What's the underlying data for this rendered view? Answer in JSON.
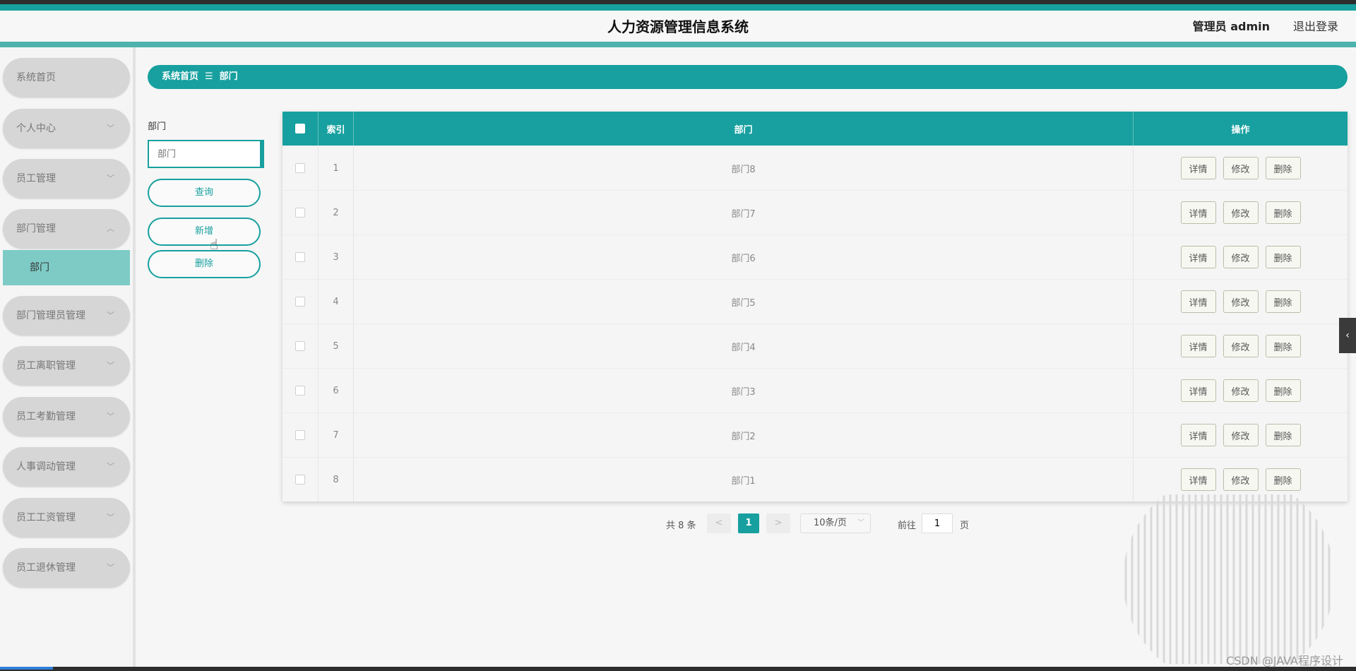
{
  "header": {
    "title": "人力资源管理信息系统",
    "admin": "管理员 admin",
    "logout": "退出登录"
  },
  "sidebar": {
    "items": [
      {
        "label": "系统首页",
        "chevron": ""
      },
      {
        "label": "个人中心",
        "chevron": "﹀"
      },
      {
        "label": "员工管理",
        "chevron": "﹀"
      },
      {
        "label": "部门管理",
        "chevron": "︿"
      },
      {
        "label": "部门管理员管理",
        "chevron": "﹀"
      },
      {
        "label": "员工离职管理",
        "chevron": "﹀"
      },
      {
        "label": "员工考勤管理",
        "chevron": "﹀"
      },
      {
        "label": "人事调动管理",
        "chevron": "﹀"
      },
      {
        "label": "员工工资管理",
        "chevron": "﹀"
      },
      {
        "label": "员工退休管理",
        "chevron": "﹀"
      }
    ],
    "submenu": {
      "label": "部门"
    }
  },
  "breadcrumb": {
    "home": "系统首页",
    "sep": "☰",
    "current": "部门"
  },
  "search": {
    "label": "部门",
    "placeholder": "部门",
    "query_button": "查询",
    "add_button": "新增",
    "delete_button": "删除"
  },
  "table": {
    "headers": {
      "index": "索引",
      "dept": "部门",
      "ops": "操作"
    },
    "rows": [
      {
        "index": "1",
        "dept": "部门8"
      },
      {
        "index": "2",
        "dept": "部门7"
      },
      {
        "index": "3",
        "dept": "部门6"
      },
      {
        "index": "4",
        "dept": "部门5"
      },
      {
        "index": "5",
        "dept": "部门4"
      },
      {
        "index": "6",
        "dept": "部门3"
      },
      {
        "index": "7",
        "dept": "部门2"
      },
      {
        "index": "8",
        "dept": "部门1"
      }
    ],
    "ops": {
      "detail": "详情",
      "edit": "修改",
      "delete": "删除"
    }
  },
  "pagination": {
    "total": "共 8 条",
    "prev": "<",
    "current": "1",
    "next": ">",
    "page_size": "10条/页",
    "goto_label": "前往",
    "goto_value": "1",
    "page_suffix": "页"
  },
  "watermark": "CSDN @JAVA程序设计",
  "colors": {
    "accent": "#17a09f",
    "submenu_active": "#7ecbc6"
  }
}
